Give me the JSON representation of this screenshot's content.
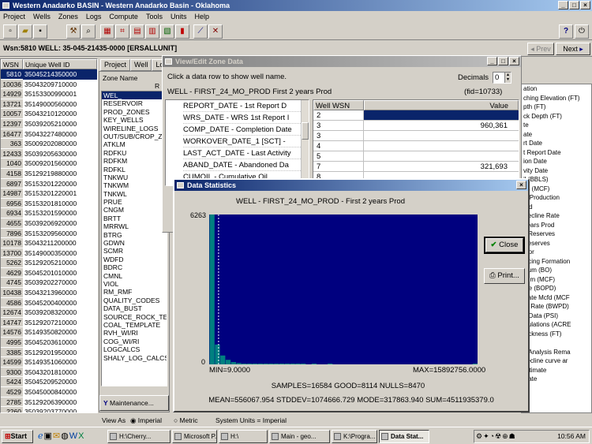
{
  "app": {
    "title": "Western Anadarko BASIN - Western Anadarko Basin - Oklahoma"
  },
  "menu": [
    "Project",
    "Wells",
    "Zones",
    "Logs",
    "Compute",
    "Tools",
    "Units",
    "Help"
  ],
  "wsn_bar": {
    "label": "Wsn:5810 WELL: 35-045-21435-0000 [ERSALLUNIT]",
    "prev": "Prev",
    "next": "Next"
  },
  "well_table": {
    "headers": [
      "WSN",
      "Unique Well ID"
    ],
    "rows": [
      [
        "5810",
        "35045214350000"
      ],
      [
        "10036",
        "35043209710000"
      ],
      [
        "14929",
        "35153300990001"
      ],
      [
        "13721",
        "35149000560000"
      ],
      [
        "10057",
        "35043210120000"
      ],
      [
        "12397",
        "35039205210000"
      ],
      [
        "16477",
        "35043227480000"
      ],
      [
        "363",
        "35009202080000"
      ],
      [
        "12433",
        "35039205630000"
      ],
      [
        "1040",
        "35009201560000"
      ],
      [
        "4158",
        "35129219880000"
      ],
      [
        "6897",
        "35153201220000"
      ],
      [
        "14987",
        "35153201220001"
      ],
      [
        "6956",
        "35153201810000"
      ],
      [
        "6934",
        "35153201590000"
      ],
      [
        "4655",
        "35039206920000"
      ],
      [
        "7896",
        "35153209560000"
      ],
      [
        "10178",
        "35043211200000"
      ],
      [
        "13700",
        "35149000350000"
      ],
      [
        "5262",
        "35129205210000"
      ],
      [
        "4629",
        "35045201010000"
      ],
      [
        "4745",
        "35039202270000"
      ],
      [
        "10438",
        "35043213960000"
      ],
      [
        "4586",
        "35045200400000"
      ],
      [
        "12674",
        "35039208320000"
      ],
      [
        "14747",
        "35129207210000"
      ],
      [
        "14576",
        "35149350820000"
      ],
      [
        "4995",
        "35045203610000"
      ],
      [
        "3385",
        "35129201950000"
      ],
      [
        "14599",
        "35149351060000"
      ],
      [
        "9300",
        "35043201810000"
      ],
      [
        "5424",
        "35045209520000"
      ],
      [
        "4529",
        "35045000840000"
      ],
      [
        "2785",
        "35129206390000"
      ],
      [
        "2260",
        "35039203770000"
      ]
    ]
  },
  "project_tabs": [
    "Project",
    "Well",
    "Lo"
  ],
  "zone_panel": {
    "header": "Zone Name",
    "col2": "R",
    "zones": [
      "WEL_",
      "RESERVOIR",
      "PROD_ZONES",
      "KEY_WELLS",
      "WIRELINE_LOGS",
      "OUT/SUB/CROP_Z",
      "ATKLM",
      "RDFKU",
      "RDFKM",
      "RDFKL",
      "TNKWU",
      "TNKWM",
      "TNKWL",
      "PRUE",
      "CNGM",
      "BRTT",
      "MRRWL",
      "BTRG",
      "GDWN",
      "SCMR",
      "WDFD",
      "BDRC",
      "CMNL",
      "VIOL",
      "RM_RMF",
      "QUALITY_CODES",
      "DATA_BUST",
      "SOURCE_ROCK_TE",
      "COAL_TEMPLATE",
      "RVH_WI/RI",
      "COG_WI/RI",
      "LOGCALCS",
      "SHALY_LOG_CALCS"
    ],
    "maintenance": "Maintenance..."
  },
  "zone_data_window": {
    "title": "View/Edit Zone Data",
    "hint": "Click a data row to show well name.",
    "decimals_label": "Decimals",
    "decimals_value": "0",
    "field_title": "WELL - FIRST_24_MO_PROD   First 2 years Prod",
    "fid": "(fid=10733)",
    "fields": [
      "REPORT_DATE - 1st Report D",
      "WRS_DATE - WRS 1st Report I",
      "COMP_DATE - Completion Date",
      "WORKOVER_DATE_1 [SCT] -",
      "LAST_ACT_DATE - Last Activity",
      "ABAND_DATE - Abandoned Da",
      "CUMOIL - Cumulative Oil"
    ],
    "table_headers": [
      "Well WSN",
      "Value"
    ],
    "table_rows": [
      [
        "2",
        ""
      ],
      [
        "3",
        "960,361"
      ],
      [
        "3",
        ""
      ],
      [
        "4",
        ""
      ],
      [
        "5",
        ""
      ],
      [
        "7",
        "321,693"
      ],
      [
        "8",
        ""
      ]
    ]
  },
  "right_fields": [
    "ation",
    "ching Elevation (FT)",
    "pth (FT)",
    "ck Depth (FT)",
    "te",
    "ate",
    "rt Date",
    "t Report Date",
    "ion Date",
    "vity Date",
    "il (BBLS)",
    "as (MCF)",
    "'s Production",
    "rod",
    "Decline Rate",
    "Years Prod",
    "s Reserves",
    "Reserves",
    "ator",
    "lucing Formation",
    "Cum (BO)",
    "cum (MCF)",
    "ate (BOPD)",
    "Rate Mcfd (MCF",
    "er Rate (BWPD)",
    "e Data (PSI)",
    "lculations (ACRE",
    "hickness (FT)",
    "",
    "e Analysis Rema",
    "decline curve ar",
    "Ultimate",
    "ulate"
  ],
  "stats_dialog": {
    "title": "Data Statistics",
    "chart_title": "WELL - FIRST_24_MO_PROD - First 2 years Prod",
    "close": "Close",
    "print": "Print...",
    "ymax_label": "6263",
    "ymin_label": "0",
    "min_label": "MIN=9.0000",
    "max_label": "MAX=15892756.0000",
    "line1": "SAMPLES=16584   GOOD=8114   NULLS=8470",
    "line2": "MEAN=556067.954   STDDEV=1074666.729   MODE=317863.940   SUM=4511935379.0"
  },
  "chart_data": {
    "type": "bar",
    "title": "WELL - FIRST_24_MO_PROD - First 2 years Prod",
    "xlim": [
      9,
      15892756
    ],
    "ylim": [
      0,
      6263
    ],
    "values": [
      6263,
      830,
      370,
      190,
      95,
      55,
      30,
      20,
      12,
      8,
      5,
      4,
      3,
      2,
      2,
      1,
      1,
      1,
      0,
      1,
      0,
      0,
      1,
      0,
      0,
      0,
      0,
      0,
      0,
      0,
      0,
      0,
      0,
      0,
      0,
      0,
      0,
      0,
      0,
      0,
      0,
      0,
      0,
      0,
      0,
      0,
      0,
      0,
      0,
      1
    ],
    "mean": 556067.954,
    "mode": 317863.94,
    "bar_color": "#008080",
    "background": "#00007f"
  },
  "status_bar": {
    "view_as": "View As",
    "imperial": "Imperial",
    "metric": "Metric",
    "system_units": "System Units = Imperial"
  },
  "taskbar": {
    "start": "Start",
    "items": [
      "H:\\Cherry...",
      "Microsoft P...",
      "H:\\",
      "Main - geo...",
      "K:\\Progra...",
      "Data Stat..."
    ],
    "clock": "10:56 AM"
  }
}
